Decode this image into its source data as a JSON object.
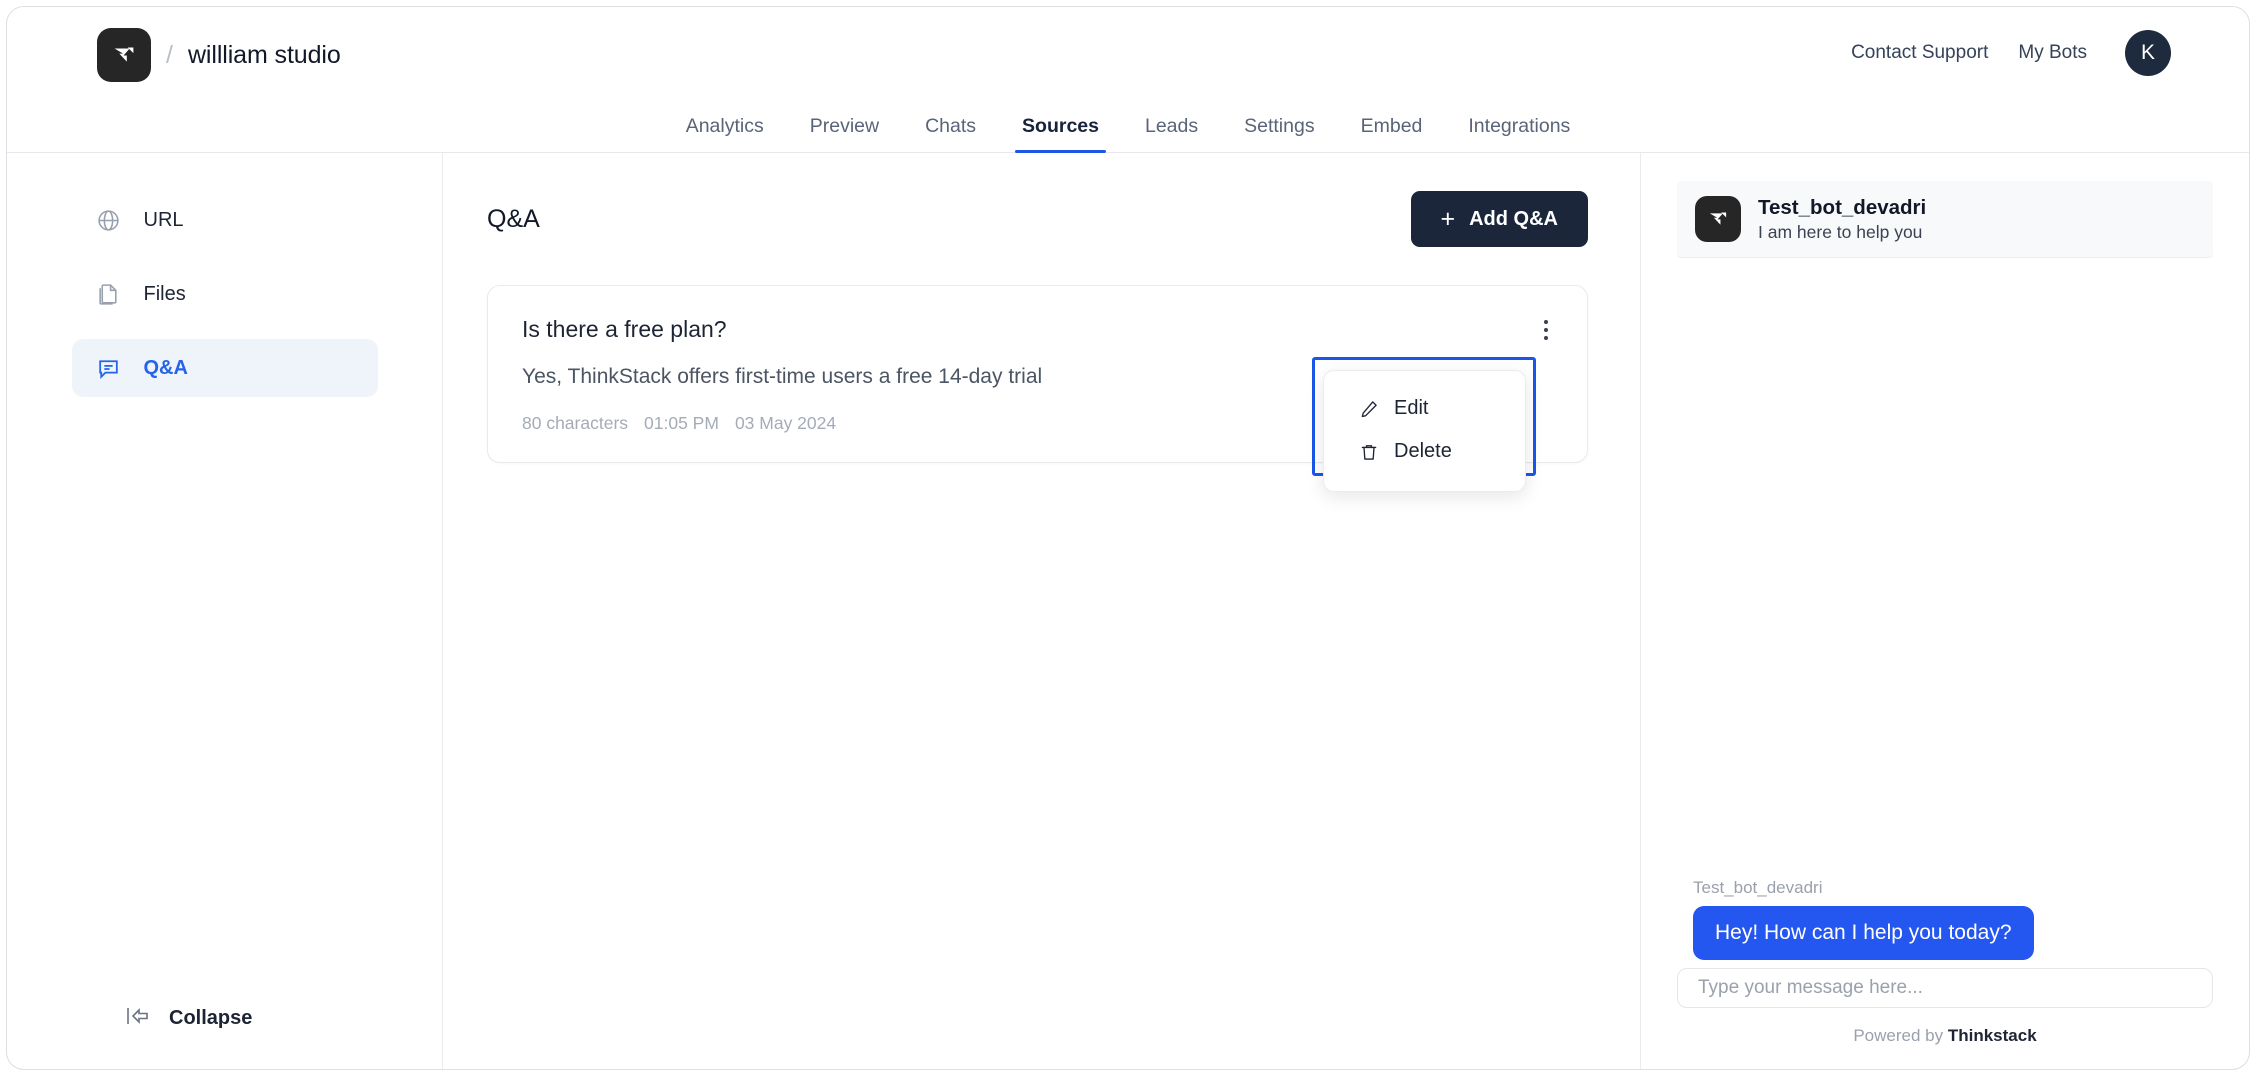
{
  "brand": {
    "logo_icon": "thinkstack-logo-icon",
    "separator": "/",
    "workspace_name": "willliam studio"
  },
  "topbar": {
    "contact_support": "Contact Support",
    "my_bots": "My Bots",
    "avatar_initial": "K"
  },
  "tabs": [
    {
      "label": "Analytics",
      "active": false
    },
    {
      "label": "Preview",
      "active": false
    },
    {
      "label": "Chats",
      "active": false
    },
    {
      "label": "Sources",
      "active": true
    },
    {
      "label": "Leads",
      "active": false
    },
    {
      "label": "Settings",
      "active": false
    },
    {
      "label": "Embed",
      "active": false
    },
    {
      "label": "Integrations",
      "active": false
    }
  ],
  "sidebar": {
    "items": [
      {
        "label": "URL",
        "icon": "globe-icon",
        "active": false
      },
      {
        "label": "Files",
        "icon": "files-icon",
        "active": false
      },
      {
        "label": "Q&A",
        "icon": "chat-bubble-icon",
        "active": true
      }
    ],
    "collapse_label": "Collapse",
    "collapse_icon": "collapse-left-icon"
  },
  "main": {
    "title": "Q&A",
    "add_button_label": "Add Q&A",
    "add_button_icon": "plus-icon",
    "cards": [
      {
        "question": "Is there a free plan?",
        "answer": "Yes, ThinkStack offers first-time users a free 14-day trial",
        "char_count": "80 characters",
        "time": "01:05 PM",
        "date": "03 May 2024",
        "menu_icon": "kebab-menu-icon"
      }
    ],
    "context_menu": {
      "visible": true,
      "items": [
        {
          "label": "Edit",
          "icon": "pencil-icon"
        },
        {
          "label": "Delete",
          "icon": "trash-icon"
        }
      ]
    }
  },
  "chat_preview": {
    "bot_name": "Test_bot_devadri",
    "bot_tagline": "I am here to help you",
    "bot_logo_icon": "thinkstack-logo-icon",
    "messages": [
      {
        "author": "Test_bot_devadri",
        "text": "Hey! How can I help you today?",
        "from": "bot"
      }
    ],
    "input_placeholder": "Type your message here...",
    "input_value": "",
    "powered_prefix": "Powered by ",
    "powered_brand": "Thinkstack"
  },
  "colors": {
    "accent_blue": "#2456f0",
    "tab_underline": "#1f56e3",
    "dark_button": "#1b263b",
    "annotation_box": "#1a56e8",
    "sidebar_active_bg": "#eff3fa",
    "sidebar_active_text": "#2563eb"
  }
}
